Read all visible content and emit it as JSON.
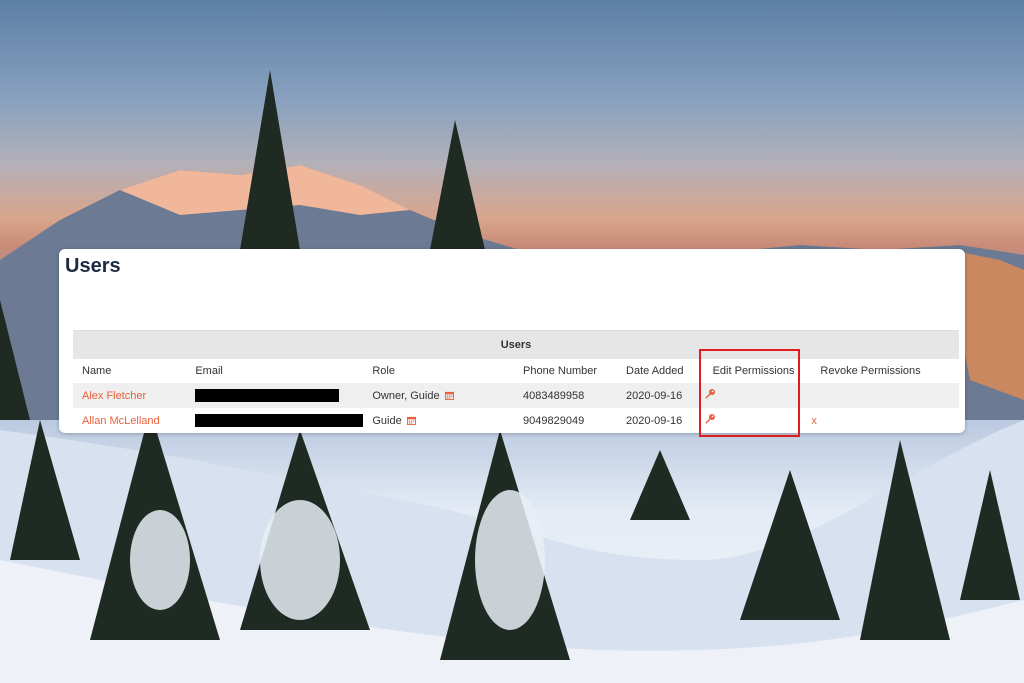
{
  "page": {
    "title": "Users",
    "accent_color": "#e8603c",
    "highlight_color": "#e01d1d"
  },
  "users_table": {
    "caption": "Users",
    "columns": [
      "Name",
      "Email",
      "Role",
      "Phone Number",
      "Date Added",
      "Edit Permissions",
      "Revoke Permissions"
    ],
    "rows": [
      {
        "name": "Alex Fletcher",
        "email": "[redacted]",
        "role": "Owner, Guide",
        "phone": "4083489958",
        "date_added": "2020-09-16",
        "edit_icon": "key-icon",
        "revoke": ""
      },
      {
        "name": "Allan McLelland",
        "email": "[redacted]",
        "role": "Guide",
        "phone": "9049829049",
        "date_added": "2020-09-16",
        "edit_icon": "key-icon",
        "revoke": "x"
      }
    ]
  }
}
